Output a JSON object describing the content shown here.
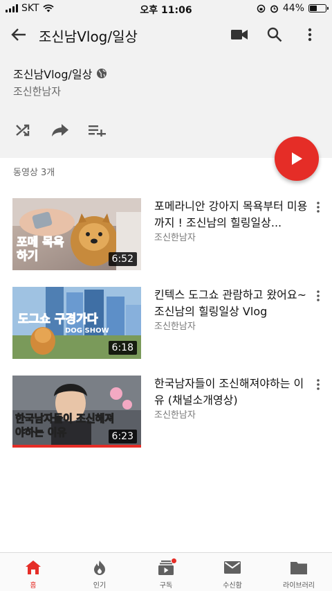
{
  "status_bar": {
    "carrier": "SKT",
    "time": "오후 11:06",
    "battery": "44%",
    "battery_level": 0.44
  },
  "app_bar": {
    "title": "조신남Vlog/일상",
    "icons": [
      "back-arrow-icon",
      "video-camera-icon",
      "search-icon",
      "more-vert-icon"
    ]
  },
  "playlist": {
    "title": "조신남Vlog/일상",
    "privacy_icon": "globe-icon",
    "owner": "조신한남자",
    "actions": [
      "shuffle-icon",
      "share-icon",
      "add-to-queue-icon"
    ],
    "video_count": "동영상 3개"
  },
  "videos": [
    {
      "title": "포메라니안 강아지 목욕부터 미용까지 !  조신남의 힐링일상...",
      "channel": "조신한남자",
      "duration": "6:52",
      "thumb_caption": "포메 목욕하기"
    },
    {
      "title": "킨텍스 도그쇼 관람하고 왔어요~조신남의 힐링일상 Vlog",
      "channel": "조신한남자",
      "duration": "6:18",
      "thumb_caption": "도그쇼 구경가다",
      "thumb_sub": "DOG SHOW"
    },
    {
      "title": "한국남자들이 조신해져야하는 이유 (채널소개영상)",
      "channel": "조신한남자",
      "duration": "6:23",
      "thumb_caption": "한국남자들이 조신해져야하는 이유"
    }
  ],
  "bottom_nav": [
    {
      "label": "홈",
      "icon": "home-icon",
      "active": true
    },
    {
      "label": "인기",
      "icon": "trending-icon",
      "active": false
    },
    {
      "label": "구독",
      "icon": "subscriptions-icon",
      "active": false
    },
    {
      "label": "수신함",
      "icon": "inbox-icon",
      "active": false
    },
    {
      "label": "라이브러리",
      "icon": "library-icon",
      "active": false
    }
  ],
  "colors": {
    "accent": "#e52d27",
    "header_bg": "#f2f2f2"
  }
}
